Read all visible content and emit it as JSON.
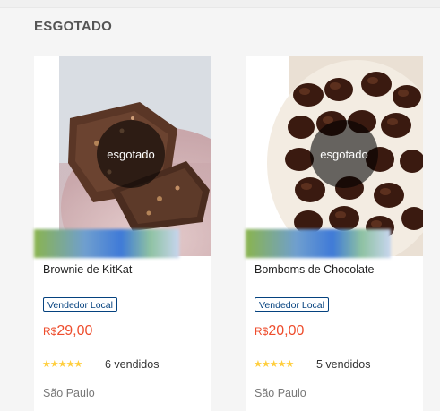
{
  "section": {
    "title": "ESGOTADO"
  },
  "products": [
    {
      "name": "Brownie de KitKat",
      "soldout_label": "esgotado",
      "badge": "Vendedor Local",
      "price_currency": "R$",
      "price_value": "29,00",
      "rating_stars": 5,
      "stars_text": "★★★★★",
      "sold": "6 vendidos",
      "location": "São Paulo",
      "image_icon": "brownie-photo"
    },
    {
      "name": "Bomboms de Chocolate",
      "soldout_label": "esgotado",
      "badge": "Vendedor Local",
      "price_currency": "R$",
      "price_value": "20,00",
      "rating_stars": 5,
      "stars_text": "★★★★★",
      "sold": "5 vendidos",
      "location": "São Paulo",
      "image_icon": "bonbons-photo"
    }
  ],
  "colors": {
    "price": "#ee4d2d",
    "badge": "#05427f",
    "stars": "#ffce3d"
  }
}
